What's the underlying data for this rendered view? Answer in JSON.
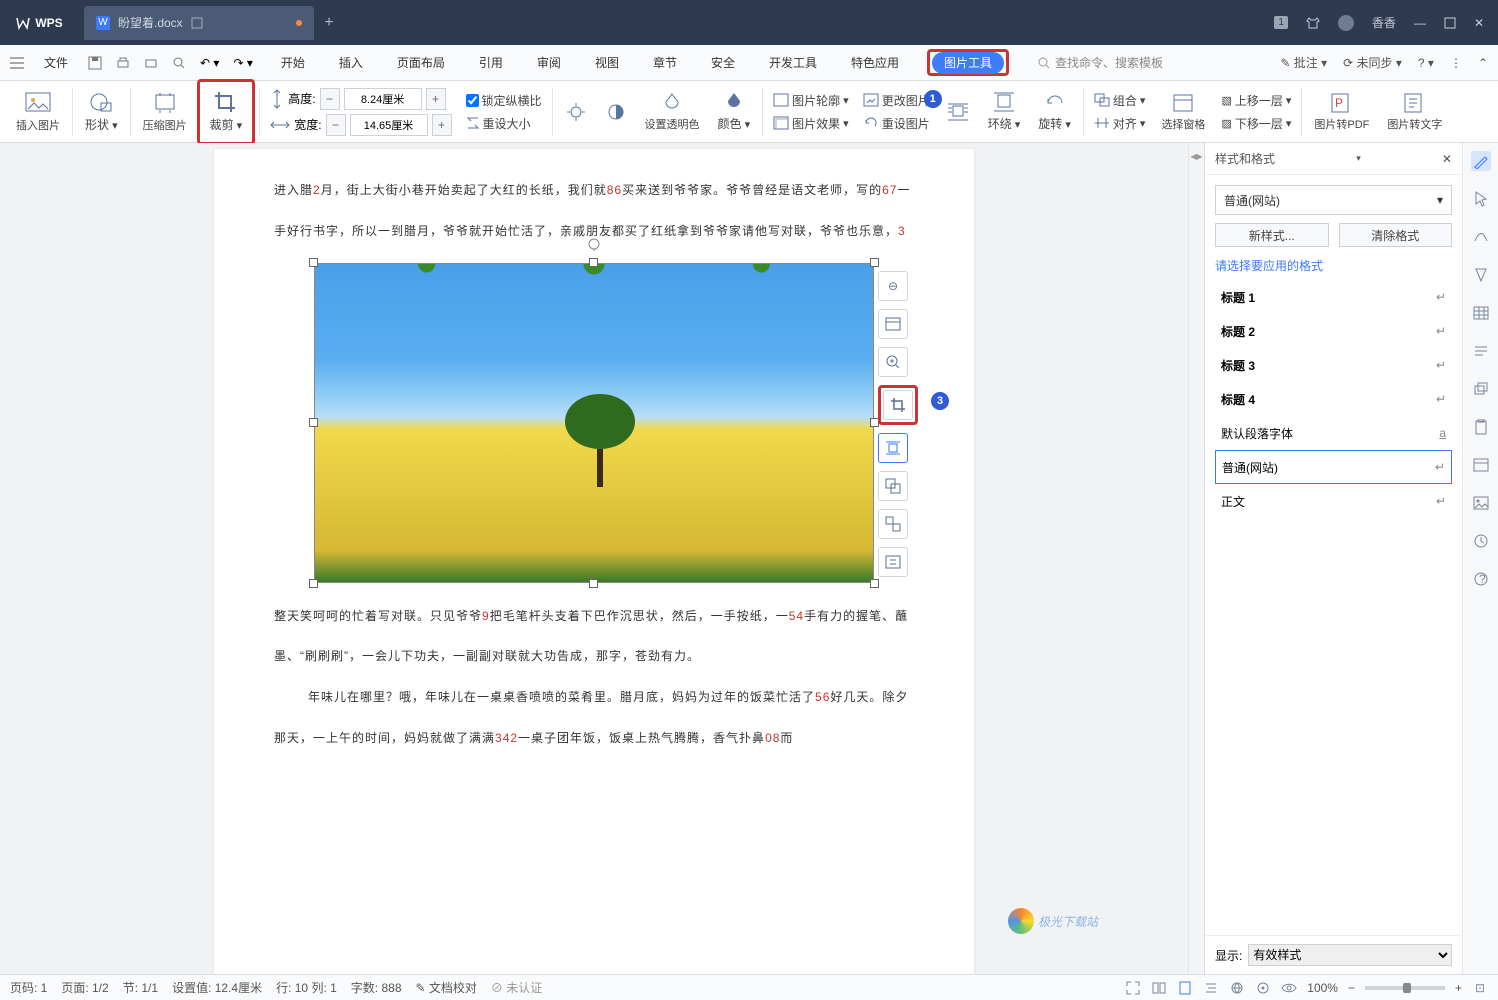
{
  "title": {
    "wps": "WPS",
    "doc": "盼望着.docx"
  },
  "titlebar": {
    "badge": "1",
    "user": "香香"
  },
  "menubar": {
    "file": "文件",
    "tabs": [
      "开始",
      "插入",
      "页面布局",
      "引用",
      "审阅",
      "视图",
      "章节",
      "安全",
      "开发工具",
      "特色应用"
    ],
    "pictool": "图片工具",
    "search_ph": "查找命令、搜索模板",
    "annotate": "批注",
    "sync": "未同步"
  },
  "ribbon": {
    "insert_pic": "插入图片",
    "shape": "形状",
    "compress": "压缩图片",
    "crop": "裁剪",
    "height": "高度:",
    "width": "宽度:",
    "h_val": "8.24厘米",
    "w_val": "14.65厘米",
    "lock": "锁定纵横比",
    "reset_size": "重设大小",
    "trans": "设置透明色",
    "color": "颜色",
    "outline": "图片轮廓",
    "change": "更改图片",
    "effect": "图片效果",
    "reset": "重设图片",
    "wrap": "环绕",
    "rotate": "旋转",
    "combine": "组合",
    "align": "对齐",
    "pane": "选择窗格",
    "up": "上移一层",
    "down": "下移一层",
    "topdf": "图片转PDF",
    "totext": "图片转文字"
  },
  "doc": {
    "p1a": "进入腊",
    "p1r": "2",
    "p1b": "月，街上大街小巷开始卖起了大红的长纸，我们就",
    "p1r2": "86",
    "p1c": "买来送到爷爷家。爷爷曾经是语文老师，写的",
    "p1r3": "67",
    "p1d": "一手好行书字，所以一到腊月，爷爷就开始忙活了，亲戚朋友都买了红纸拿到爷爷家请他写对联，爷爷也乐意，",
    "p1r4": "3",
    "p2a": "整天笑呵呵的忙着写对联。只见爷爷",
    "p2r": "9",
    "p2b": "把毛笔杆头支着下巴作沉思状，然后，一手按纸，一",
    "p2r2": "54",
    "p2c": "手有力的握笔、蘸墨、“刷刷刷”，一会儿下功夫，一副副对联就大功告成，那字，苍劲有力。",
    "p3a": "年味儿在哪里？哦，年味儿在一桌桌香喷喷的菜肴里。腊月底，妈妈为过年的饭菜忙活了",
    "p3r": "56",
    "p3b": "好几天。除夕那天，一上午的时间，妈妈就做了满满",
    "p3r2": "342",
    "p3c": "一桌子团年饭，饭桌上热气腾腾，香气扑鼻",
    "p3r3": "08",
    "p3d": "而"
  },
  "sidepanel": {
    "title": "样式和格式",
    "combo": "普通(网站)",
    "new": "新样式...",
    "clear": "清除格式",
    "choose": "请选择要应用的格式",
    "styles": [
      "标题 1",
      "标题 2",
      "标题 3",
      "标题 4"
    ],
    "default": "默认段落字体",
    "normal": "普通(网站)",
    "body": "正文",
    "show": "显示:",
    "show_val": "有效样式"
  },
  "status": {
    "page": "页码: 1",
    "pages": "页面: 1/2",
    "sect": "节: 1/1",
    "pos": "设置值: 12.4厘米",
    "rowcol": "行: 10  列: 1",
    "words": "字数: 888",
    "proof": "文档校对",
    "unauth": "未认证",
    "zoom": "100%"
  },
  "watermark": "极光下载站"
}
